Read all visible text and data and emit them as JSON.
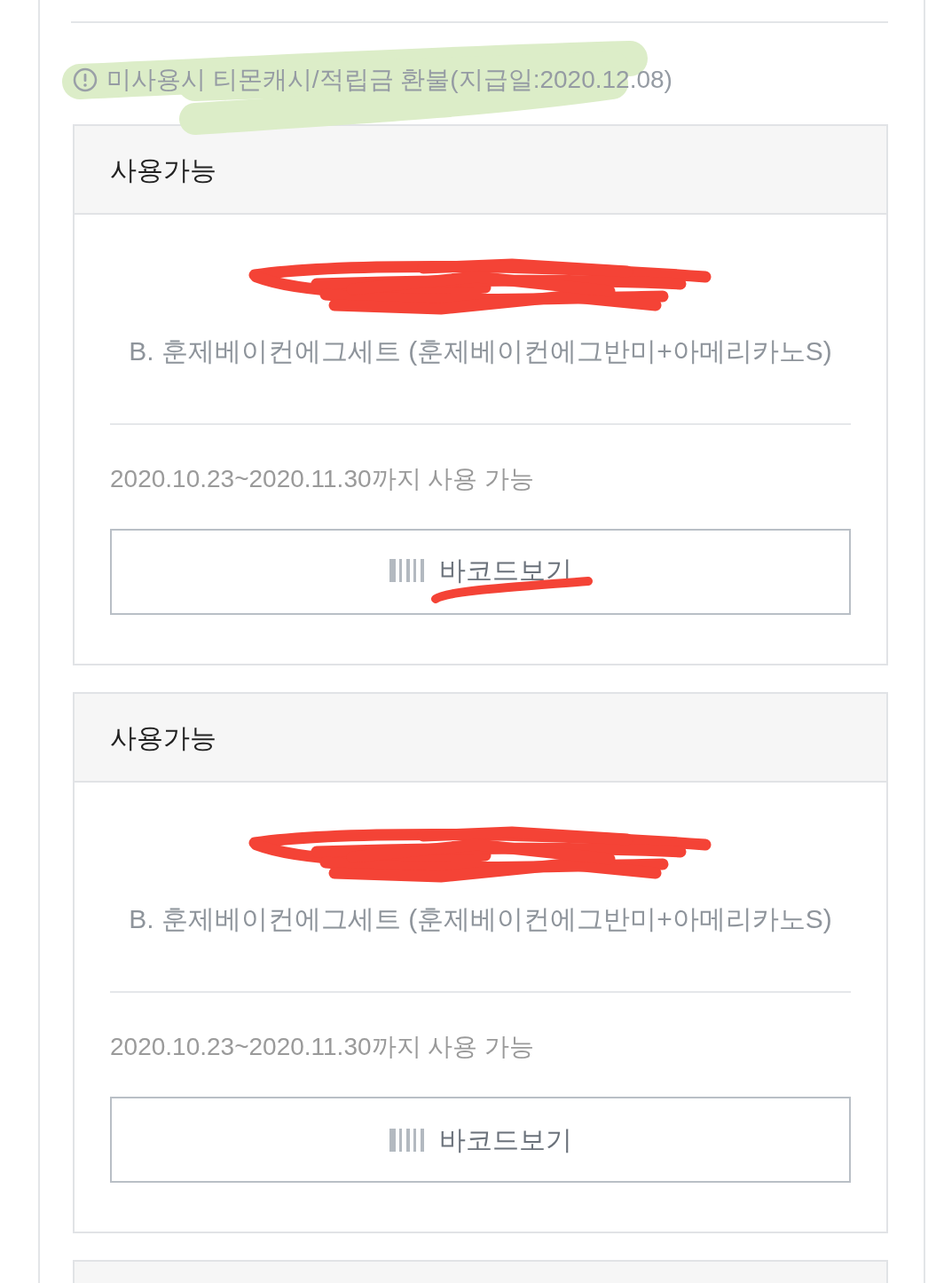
{
  "notice": {
    "text": "미사용시 티몬캐시/적립금 환불(지급일:2020.12.08)",
    "highlighted": true
  },
  "cards": [
    {
      "status": "사용가능",
      "code_redacted": true,
      "product": "B. 훈제베이컨에그세트 (훈제베이컨에그반미+아메리카노S)",
      "validity": "2020.10.23~2020.11.30까지 사용 가능",
      "button": {
        "label": "바코드보기",
        "underlined": true
      }
    },
    {
      "status": "사용가능",
      "code_redacted": true,
      "product": "B. 훈제베이컨에그세트 (훈제베이컨에그반미+아메리카노S)",
      "validity": "2020.10.23~2020.11.30까지 사용 가능",
      "button": {
        "label": "바코드보기",
        "underlined": false
      }
    }
  ]
}
